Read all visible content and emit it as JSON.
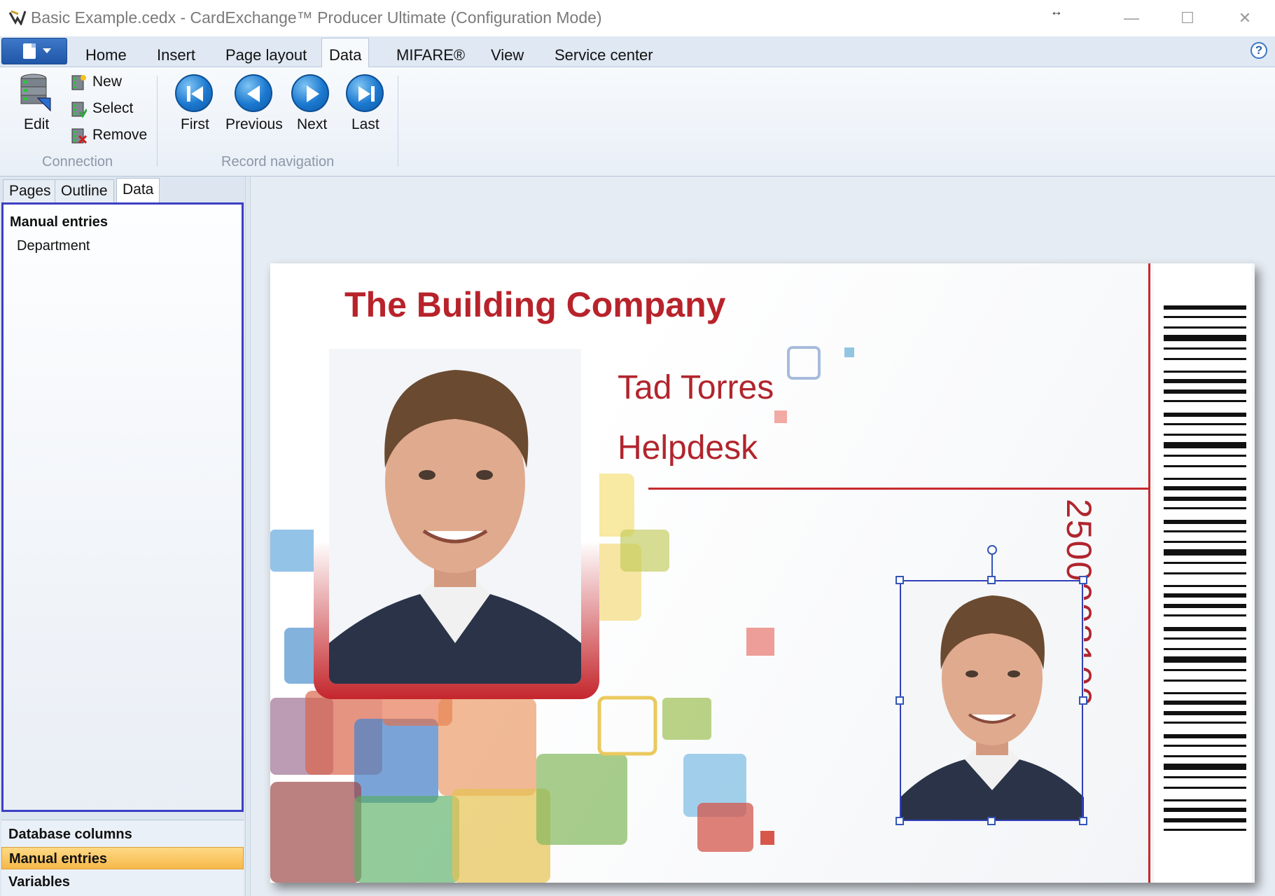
{
  "window": {
    "title": "Basic Example.cedx - CardExchange™ Producer Ultimate (Configuration Mode)",
    "resize_glyph": "↔",
    "minimize": "—",
    "maximize": "☐",
    "close": "✕"
  },
  "ribbon_tabs": [
    "Home",
    "Insert",
    "Page layout",
    "Data",
    "MIFARE®",
    "View",
    "Service center"
  ],
  "active_tab": "Data",
  "help_icon": "?",
  "connection_group": {
    "label": "Connection",
    "edit": "Edit",
    "new": "New",
    "select": "Select",
    "remove": "Remove"
  },
  "record_nav_group": {
    "label": "Record navigation",
    "first": "First",
    "previous": "Previous",
    "next": "Next",
    "last": "Last"
  },
  "panel_tabs": [
    "Pages",
    "Outline",
    "Data"
  ],
  "active_panel_tab": "Data",
  "tree": {
    "heading": "Manual entries",
    "items": [
      "Department"
    ]
  },
  "nav_list": [
    "Database columns",
    "Manual entries",
    "Variables"
  ],
  "active_nav": "Manual entries",
  "card": {
    "company": "The Building Company",
    "name": "Tad Torres",
    "department": "Helpdesk",
    "barcode_number": "2500003100"
  },
  "colors": {
    "brand_red": "#b8232b",
    "selection": "#3140b8",
    "active_nav": "#f6b84a"
  },
  "icons": {
    "edit": "database-edit-icon",
    "new": "database-new-icon",
    "select": "database-select-icon",
    "remove": "database-remove-icon",
    "first": "first-record-icon",
    "previous": "previous-record-icon",
    "next": "next-record-icon",
    "last": "last-record-icon"
  }
}
